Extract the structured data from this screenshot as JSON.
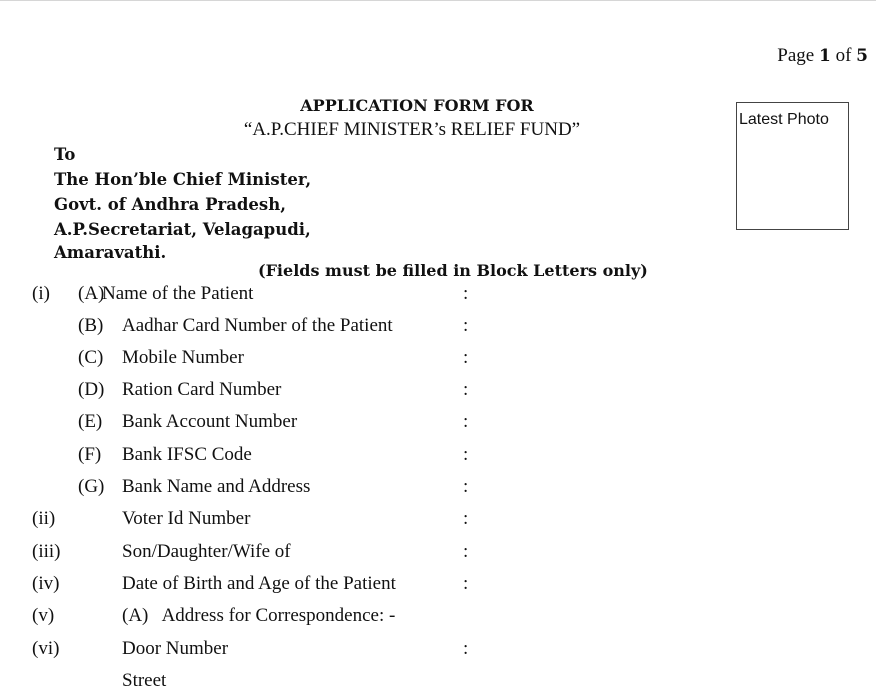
{
  "page_indicator": {
    "prefix": "Page",
    "current": "1",
    "of": "of",
    "total": "5"
  },
  "header": {
    "title": "APPLICATION FORM FOR",
    "subtitle": "“A.P.CHIEF MINISTER’s RELIEF FUND”"
  },
  "photo_box": {
    "label": "Latest Photo"
  },
  "address": {
    "lines": [
      "To",
      "The Hon’ble Chief Minister,",
      "Govt. of Andhra Pradesh,",
      "A.P.Secretariat, Velagapudi,",
      "Amaravathi."
    ]
  },
  "instruction": "(Fields must be filled in Block Letters only)",
  "fields": [
    {
      "number": "(i)",
      "sub": "(A)",
      "label": "Name of the Patient",
      "colon": ":"
    },
    {
      "number": "",
      "sub": "(B)",
      "label": "Aadhar Card Number of the Patient",
      "colon": ":"
    },
    {
      "number": "",
      "sub": "(C)",
      "label": "Mobile Number",
      "colon": ":"
    },
    {
      "number": "",
      "sub": "(D)",
      "label": "Ration Card Number",
      "colon": ":"
    },
    {
      "number": "",
      "sub": "(E)",
      "label": "Bank Account Number",
      "colon": ":"
    },
    {
      "number": "",
      "sub": "(F)",
      "label": "Bank IFSC Code",
      "colon": ":"
    },
    {
      "number": "",
      "sub": "(G)",
      "label": "Bank Name and Address",
      "colon": ":"
    },
    {
      "number": "(ii)",
      "sub": "",
      "label": "Voter Id Number",
      "colon": ":"
    },
    {
      "number": "(iii)",
      "sub": "",
      "label": "Son/Daughter/Wife of",
      "colon": ":"
    },
    {
      "number": "(iv)",
      "sub": "",
      "label": "Date of Birth and Age of the Patient",
      "colon": ":"
    },
    {
      "number": "(v)",
      "sub": "",
      "label": "(A)   Address for Correspondence: -",
      "colon": ""
    },
    {
      "number": "(vi)",
      "sub": "",
      "label": "Door Number",
      "colon": ":"
    },
    {
      "number": "",
      "sub": "",
      "label": "Street",
      "colon": ""
    }
  ]
}
